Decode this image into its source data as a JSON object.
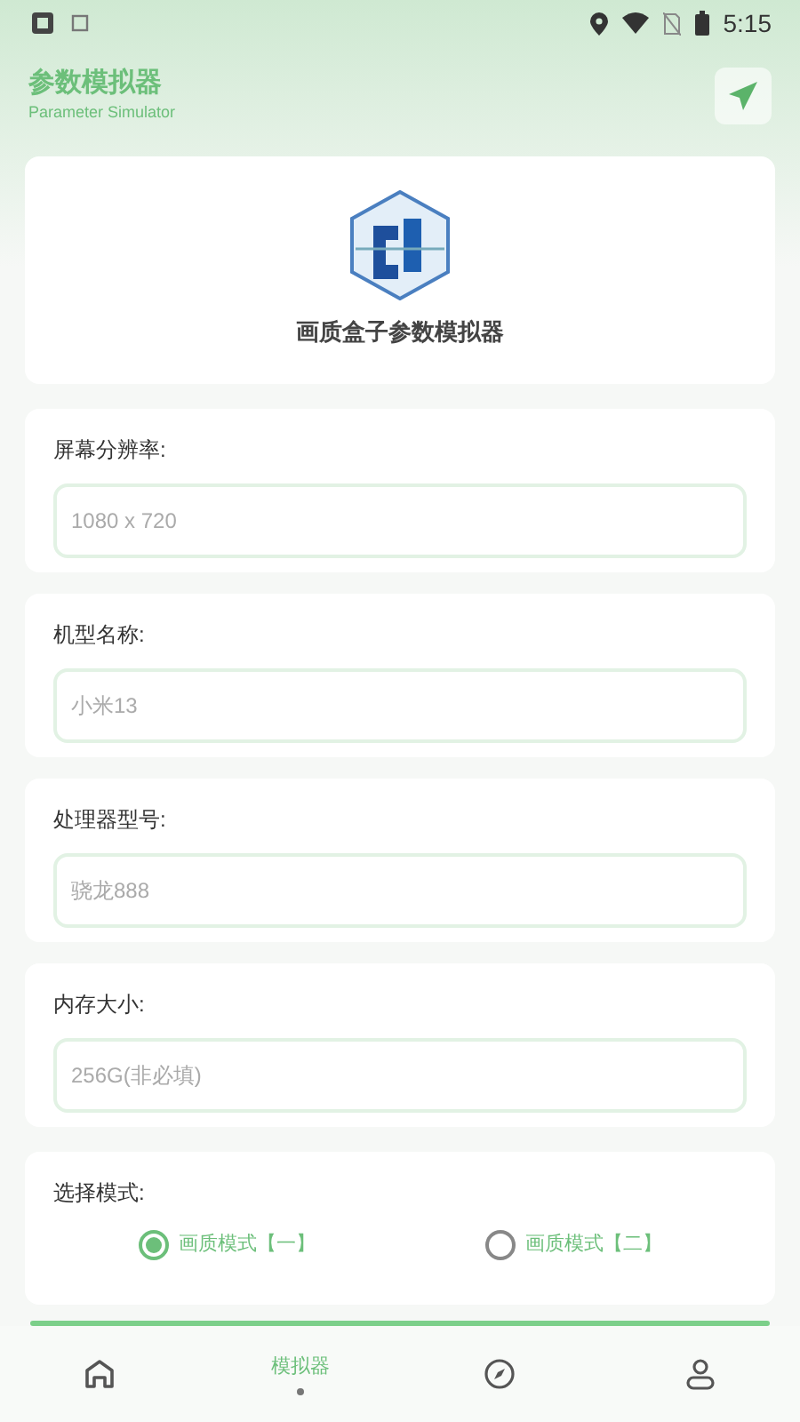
{
  "status_bar": {
    "time": "5:15"
  },
  "header": {
    "title": "参数模拟器",
    "subtitle": "Parameter Simulator"
  },
  "logo_card": {
    "caption": "画质盒子参数模拟器"
  },
  "fields": [
    {
      "label": "屏幕分辨率:",
      "placeholder": "1080 x 720"
    },
    {
      "label": "机型名称:",
      "placeholder": "小米13"
    },
    {
      "label": "处理器型号:",
      "placeholder": "骁龙888"
    },
    {
      "label": "内存大小:",
      "placeholder": "256G(非必填)"
    }
  ],
  "mode": {
    "label": "选择模式:",
    "options": [
      {
        "label": "画质模式【一】",
        "selected": true
      },
      {
        "label": "画质模式【二】",
        "selected": false
      }
    ]
  },
  "nav": [
    {
      "kind": "home",
      "selected": false
    },
    {
      "label": "模拟器",
      "selected": true
    },
    {
      "kind": "discover",
      "selected": false
    },
    {
      "kind": "profile",
      "selected": false
    }
  ]
}
